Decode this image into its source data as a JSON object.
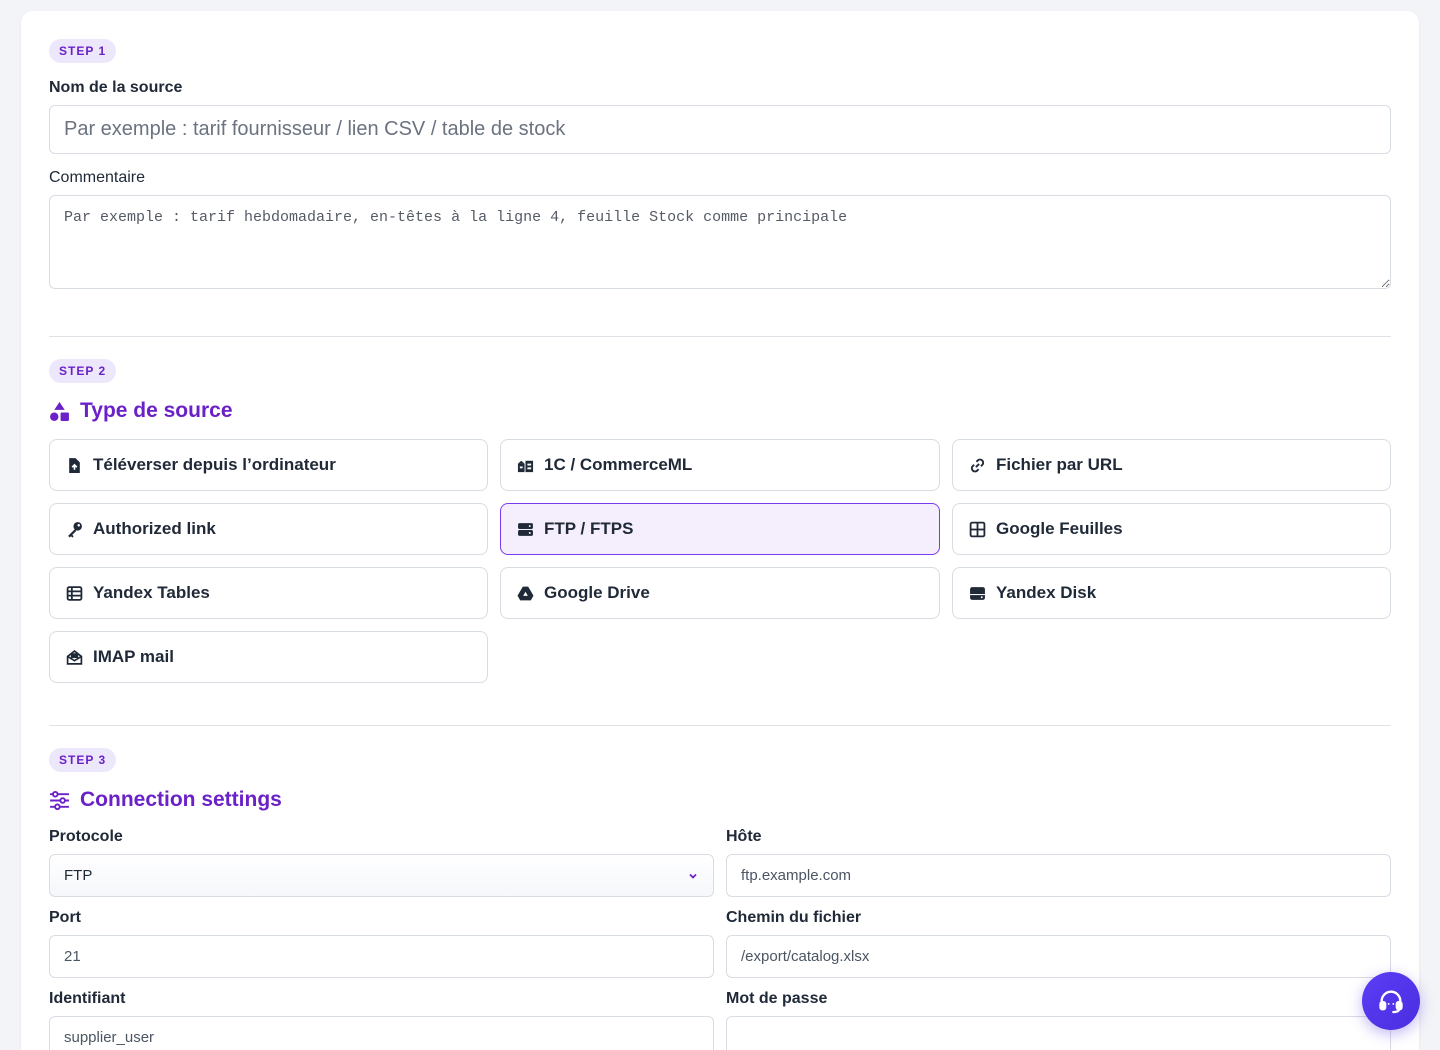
{
  "step1": {
    "badge": "STEP 1",
    "source_name_label": "Nom de la source",
    "source_name_placeholder": "Par exemple : tarif fournisseur / lien CSV / table de stock",
    "comment_label": "Commentaire",
    "comment_placeholder": "Par exemple : tarif hebdomadaire, en-têtes à la ligne 4, feuille Stock comme principale"
  },
  "step2": {
    "badge": "STEP 2",
    "title": "Type de source",
    "types": [
      {
        "label": "Téléverser depuis l’ordinateur",
        "icon": "file-upload-icon",
        "active": false
      },
      {
        "label": "1C / CommerceML",
        "icon": "warehouse-icon",
        "active": false
      },
      {
        "label": "Fichier par URL",
        "icon": "link-icon",
        "active": false
      },
      {
        "label": "Authorized link",
        "icon": "key-icon",
        "active": false
      },
      {
        "label": "FTP / FTPS",
        "icon": "server-icon",
        "active": true
      },
      {
        "label": "Google Feuilles",
        "icon": "table-grid-icon",
        "active": false
      },
      {
        "label": "Yandex Tables",
        "icon": "table-list-icon",
        "active": false
      },
      {
        "label": "Google Drive",
        "icon": "google-drive-icon",
        "active": false
      },
      {
        "label": "Yandex Disk",
        "icon": "hard-drive-icon",
        "active": false
      },
      {
        "label": "IMAP mail",
        "icon": "envelope-open-icon",
        "active": false
      }
    ]
  },
  "step3": {
    "badge": "STEP 3",
    "title": "Connection settings",
    "protocol_label": "Protocole",
    "protocol_value": "FTP",
    "host_label": "Hôte",
    "host_placeholder": "ftp.example.com",
    "port_label": "Port",
    "port_value": "21",
    "path_label": "Chemin du fichier",
    "path_placeholder": "/export/catalog.xlsx",
    "login_label": "Identifiant",
    "login_value": "supplier_user",
    "password_label": "Mot de passe",
    "password_value": ""
  },
  "support": {
    "icon": "headset-icon"
  },
  "colors": {
    "accent": "#6b21c8",
    "badge_bg": "#ede7fb",
    "active_bg": "#f5eefc",
    "support": "#5b3df5"
  }
}
